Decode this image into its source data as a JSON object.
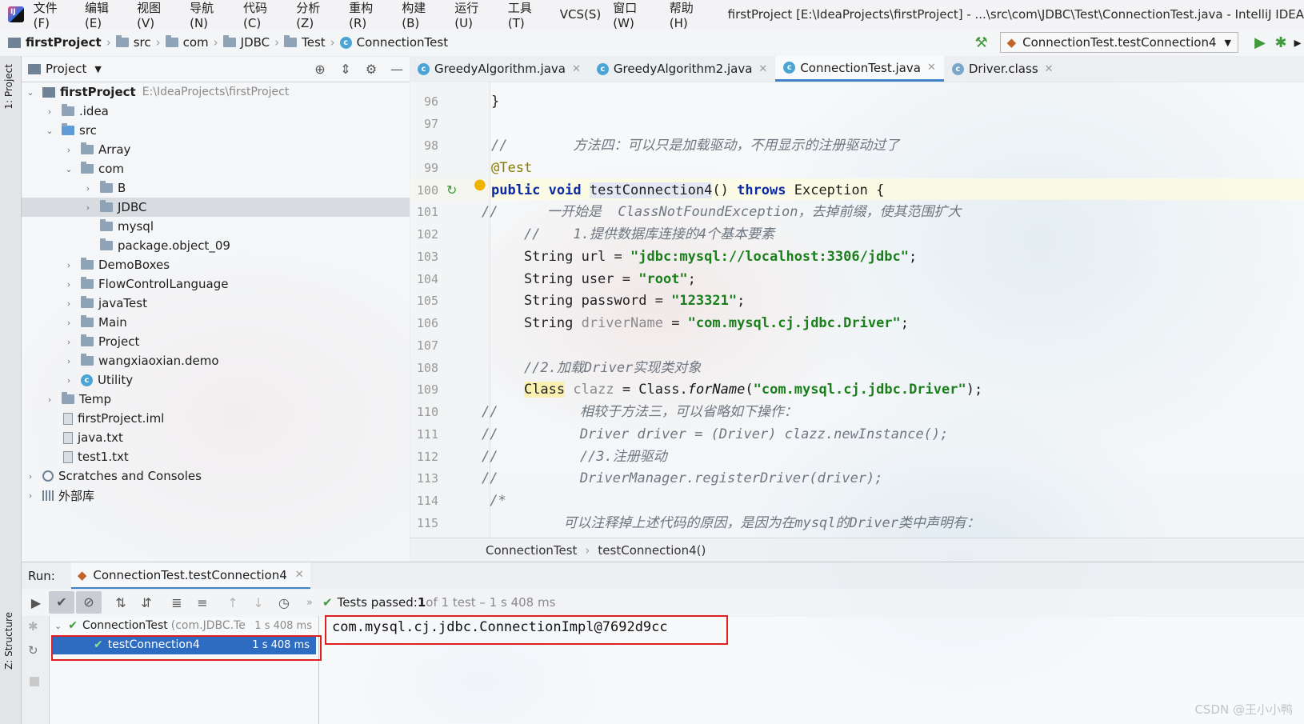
{
  "menu": {
    "items": [
      "文件(F)",
      "编辑(E)",
      "视图(V)",
      "导航(N)",
      "代码(C)",
      "分析(Z)",
      "重构(R)",
      "构建(B)",
      "运行(U)",
      "工具(T)",
      "VCS(S)",
      "窗口(W)",
      "帮助(H)"
    ],
    "window_title": "firstProject [E:\\IdeaProjects\\firstProject] - ...\\src\\com\\JDBC\\Test\\ConnectionTest.java - IntelliJ IDEA"
  },
  "nav": {
    "crumbs": [
      "firstProject",
      "src",
      "com",
      "JDBC",
      "Test",
      "ConnectionTest"
    ],
    "run_config": "ConnectionTest.testConnection4"
  },
  "left_strip": {
    "project_tab": "1: Project",
    "structure_tab": "Z: Structure"
  },
  "project_panel": {
    "title": "Project",
    "root_name": "firstProject",
    "root_path": "E:\\IdeaProjects\\firstProject",
    "rows": [
      {
        "label": ".idea"
      },
      {
        "label": "src"
      },
      {
        "label": "Array"
      },
      {
        "label": "com"
      },
      {
        "label": "B"
      },
      {
        "label": "JDBC"
      },
      {
        "label": "mysql"
      },
      {
        "label": "package.object_09"
      },
      {
        "label": "DemoBoxes"
      },
      {
        "label": "FlowControlLanguage"
      },
      {
        "label": "javaTest"
      },
      {
        "label": "Main"
      },
      {
        "label": "Project"
      },
      {
        "label": "wangxiaoxian.demo"
      },
      {
        "label": "Utility"
      },
      {
        "label": "Temp"
      },
      {
        "label": "firstProject.iml"
      },
      {
        "label": "java.txt"
      },
      {
        "label": "test1.txt"
      },
      {
        "label": "Scratches and Consoles"
      },
      {
        "label": "外部库"
      }
    ]
  },
  "editor_tabs": [
    "GreedyAlgorithm.java",
    "GreedyAlgorithm2.java",
    "ConnectionTest.java",
    "Driver.class"
  ],
  "editor": {
    "line_numbers": [
      "96",
      "97",
      "98",
      "99",
      "100",
      "101",
      "102",
      "103",
      "104",
      "105",
      "106",
      "107",
      "108",
      "109",
      "110",
      "111",
      "112",
      "113",
      "114",
      "115"
    ],
    "code": {
      "l96": "}",
      "l98": "//        方法四：可以只是加载驱动，不用显示的注册驱动过了",
      "l99": "@Test",
      "l100_kw1": "public void ",
      "l100_fn": "testConnection4",
      "l100_mid": "() ",
      "l100_kw2": "throws",
      "l100_end": " Exception {",
      "l101": "//      一开始是  ClassNotFoundException，去掉前缀，使其范围扩大",
      "l102": "    //    1.提供数据库连接的4个基本要素",
      "l103_a": "    String url = ",
      "l103_s": "\"jdbc:mysql://localhost:3306/jdbc\"",
      "l104_a": "    String user = ",
      "l104_s": "\"root\"",
      "l105_a": "    String password = ",
      "l105_s": "\"123321\"",
      "l106_a": "    String ",
      "l106_v": "driverName",
      "l106_b": " = ",
      "l106_s": "\"com.mysql.cj.jdbc.Driver\"",
      "l108": "    //2.加载Driver实现类对象",
      "l109_cls": "Class",
      "l109_v": "clazz",
      "l109_b": " = Class.",
      "l109_fn": "forName",
      "l109_s": "\"com.mysql.cj.jdbc.Driver\"",
      "l110": "//          相较于方法三，可以省略如下操作：",
      "l111": "//          Driver driver = (Driver) clazz.newInstance();",
      "l112": "//          //3.注册驱动",
      "l113": "//          DriverManager.registerDriver(driver);",
      "l114": " /*",
      "l115": "          可以注释掉上述代码的原因，是因为在mysql的Driver类中声明有："
    },
    "breadcrumb": [
      "ConnectionTest",
      "testConnection4()"
    ]
  },
  "run": {
    "label": "Run:",
    "tab": "ConnectionTest.testConnection4",
    "status_prefix": "Tests passed: ",
    "passed": "1",
    "status_suffix": " of 1 test – 1 s 408 ms",
    "tree": [
      {
        "label": "ConnectionTest",
        "hint": "(com.JDBC.Te",
        "time": "1 s 408 ms"
      },
      {
        "label": "testConnection4",
        "time": "1 s 408 ms"
      }
    ],
    "console_output": "com.mysql.cj.jdbc.ConnectionImpl@7692d9cc"
  },
  "watermark": "CSDN @王小小鸭",
  "colors": {
    "accent": "#4083c9",
    "selection": "#2d6cc0",
    "highlight_box": "#e02020",
    "pass_green": "#3f9a3c"
  }
}
